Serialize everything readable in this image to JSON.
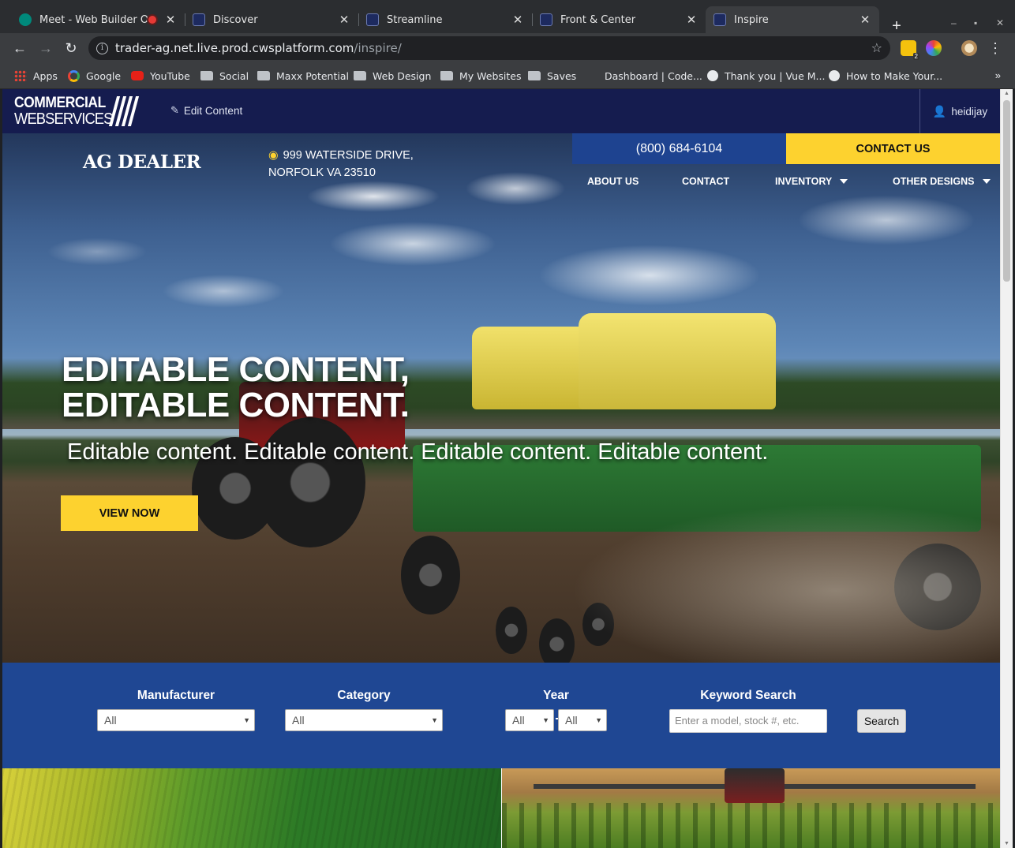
{
  "browser": {
    "tabs": [
      {
        "title": "Meet - Web Builder Offic",
        "icon": "meet-icon",
        "recording": true
      },
      {
        "title": "Discover",
        "icon": "cws-favicon"
      },
      {
        "title": "Streamline",
        "icon": "cws-favicon"
      },
      {
        "title": "Front & Center",
        "icon": "cws-favicon"
      },
      {
        "title": "Inspire",
        "icon": "cws-favicon",
        "active": true
      }
    ],
    "url_host": "trader-ag.net.live.prod.cwsplatform.com",
    "url_path": "/inspire/",
    "bookmarks": [
      {
        "label": "Apps",
        "icon": "apps-grid-icon"
      },
      {
        "label": "Google",
        "icon": "google-icon"
      },
      {
        "label": "YouTube",
        "icon": "youtube-icon"
      },
      {
        "label": "Social",
        "icon": "folder-icon"
      },
      {
        "label": "Maxx Potential",
        "icon": "folder-icon"
      },
      {
        "label": "Web Design",
        "icon": "folder-icon"
      },
      {
        "label": "My Websites",
        "icon": "folder-icon"
      },
      {
        "label": "Saves",
        "icon": "folder-icon"
      },
      {
        "label": "Dashboard | Code...",
        "icon": "page-icon"
      },
      {
        "label": "Thank you | Vue M...",
        "icon": "globe-icon"
      },
      {
        "label": "How to Make Your...",
        "icon": "globe-icon"
      }
    ],
    "bookmarks_more": "»",
    "extension_badge": "2"
  },
  "cms_bar": {
    "logo_line1": "COMMERCIAL",
    "logo_line2": "WEBSERVICES",
    "edit_label": "Edit Content",
    "username": "heidijay"
  },
  "site": {
    "brand": "AG DEALER",
    "address_line1": "999 WATERSIDE DRIVE,",
    "address_line2": "NORFOLK VA 23510",
    "phone": "(800) 684-6104",
    "contact_label": "CONTACT US",
    "nav": [
      {
        "label": "ABOUT US",
        "dropdown": false
      },
      {
        "label": "CONTACT",
        "dropdown": false
      },
      {
        "label": "INVENTORY",
        "dropdown": true
      },
      {
        "label": "OTHER DESIGNS",
        "dropdown": true
      }
    ],
    "colors": {
      "navy": "#151c4f",
      "blue": "#1f4793",
      "yellow": "#fdd22f"
    }
  },
  "hero": {
    "title_line1": "EDITABLE CONTENT,",
    "title_line2": "EDITABLE CONTENT.",
    "subtitle": "Editable content. Editable content. Editable content. Editable content.",
    "cta": "VIEW NOW"
  },
  "search": {
    "manufacturer_label": "Manufacturer",
    "manufacturer_value": "All",
    "category_label": "Category",
    "category_value": "All",
    "year_label": "Year",
    "year_from": "All",
    "year_to": "All",
    "keyword_label": "Keyword Search",
    "keyword_placeholder": "Enter a model, stock #, etc.",
    "search_button": "Search"
  }
}
